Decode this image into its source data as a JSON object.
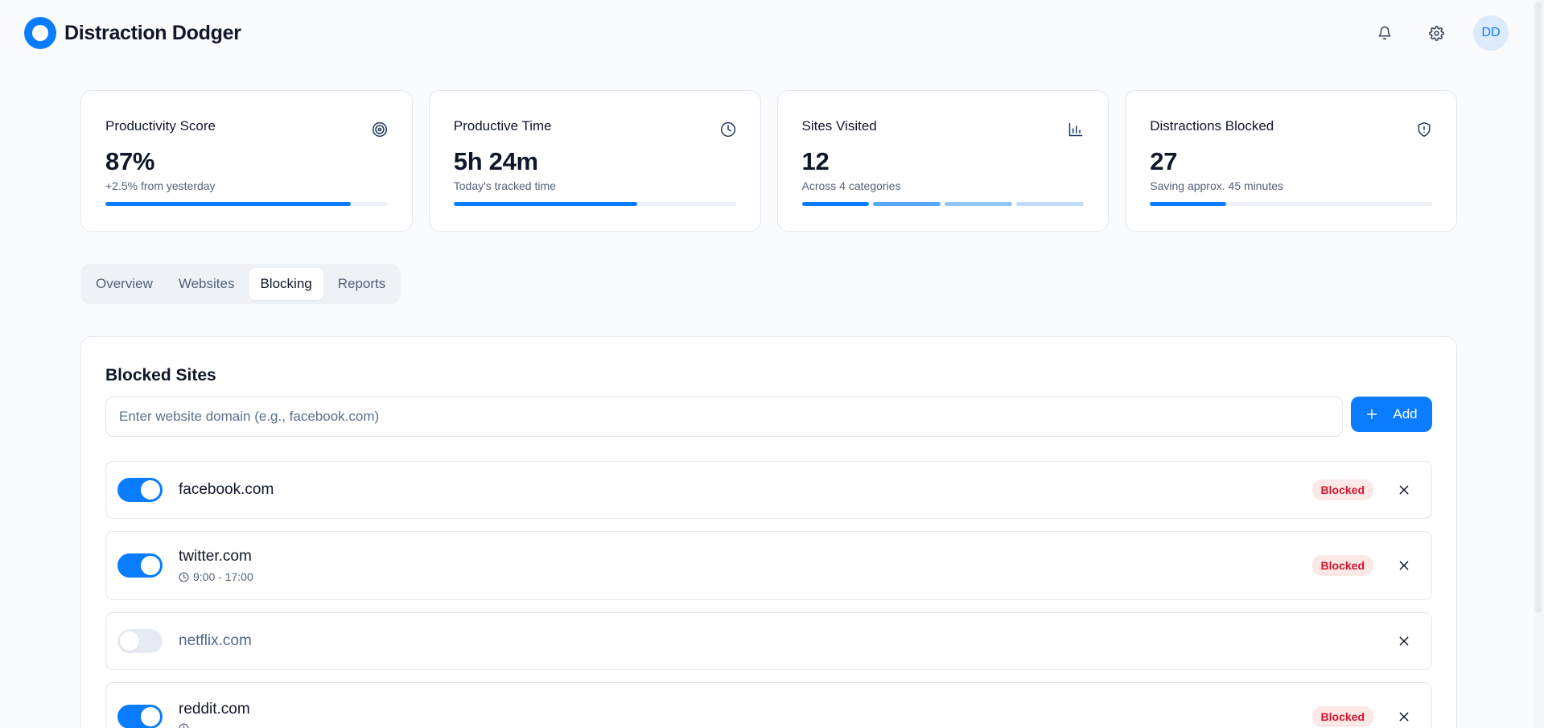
{
  "app": {
    "name": "Distraction Dodger",
    "avatar_initials": "DD",
    "accent_color": "#0a7cff"
  },
  "header": {
    "icons": [
      "bell-icon",
      "gear-icon"
    ]
  },
  "stats": [
    {
      "title": "Productivity Score",
      "icon": "target-icon",
      "value": "87%",
      "subtitle": "+2.5% from yesterday",
      "progress": 0.87
    },
    {
      "title": "Productive Time",
      "icon": "clock-icon",
      "value": "5h 24m",
      "subtitle": "Today's tracked time",
      "progress": 0.65
    },
    {
      "title": "Sites Visited",
      "icon": "bar-chart-icon",
      "value": "12",
      "subtitle": "Across 4 categories",
      "segment_colors": [
        "#0a7cff",
        "#5aa7f7",
        "#93c4f8",
        "#c0dcfa"
      ]
    },
    {
      "title": "Distractions Blocked",
      "icon": "shield-icon",
      "value": "27",
      "subtitle": "Saving approx. 45 minutes",
      "progress": 0.27
    }
  ],
  "tabs": [
    {
      "label": "Overview",
      "active": false
    },
    {
      "label": "Websites",
      "active": false
    },
    {
      "label": "Blocking",
      "active": true
    },
    {
      "label": "Reports",
      "active": false
    }
  ],
  "blocked_sites": {
    "title": "Blocked Sites",
    "input_placeholder": "Enter website domain (e.g., facebook.com)",
    "add_label": "Add",
    "items": [
      {
        "domain": "facebook.com",
        "enabled": true,
        "status": "Blocked",
        "schedule": ""
      },
      {
        "domain": "twitter.com",
        "enabled": true,
        "status": "Blocked",
        "schedule": "9:00 - 17:00"
      },
      {
        "domain": "netflix.com",
        "enabled": false,
        "status": "",
        "schedule": ""
      },
      {
        "domain": "reddit.com",
        "enabled": true,
        "status": "Blocked",
        "schedule": ""
      }
    ]
  }
}
